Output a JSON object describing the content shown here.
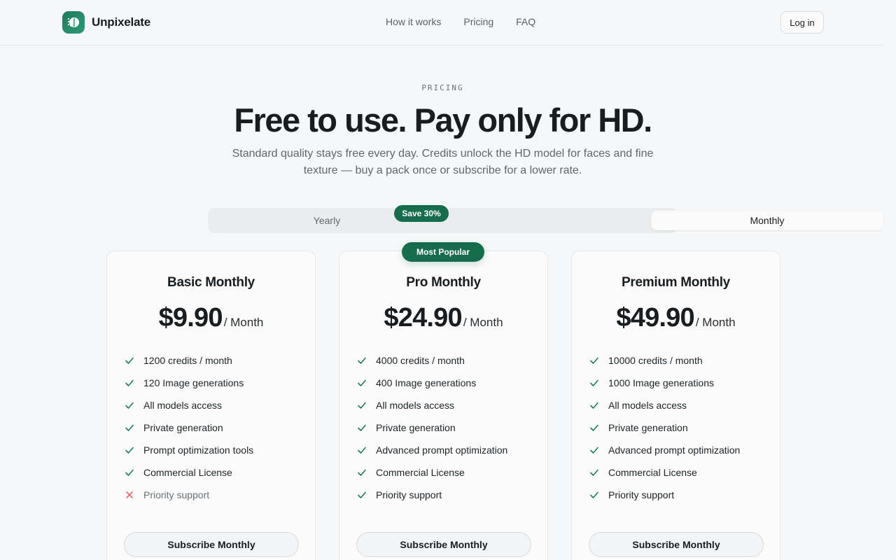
{
  "brand": {
    "name": "Unpixelate"
  },
  "nav": {
    "items": [
      "How it works",
      "Pricing",
      "FAQ"
    ]
  },
  "header": {
    "login_label": "Log in"
  },
  "hero": {
    "eyebrow": "PRICING",
    "title": "Free to use. Pay only for HD.",
    "subtitle": "Standard quality stays free every day. Credits unlock the HD model for faces and fine texture — buy a pack once or subscribe for a lower rate."
  },
  "billing_toggle": {
    "yearly_label": "Yearly",
    "monthly_label": "Monthly",
    "selected": "Monthly",
    "save_badge": "Save 30%"
  },
  "popular_badge": "Most Popular",
  "plans": [
    {
      "name": "Basic Monthly",
      "price": "$9.90",
      "period": "/ Month",
      "button": "Subscribe Monthly",
      "features": [
        {
          "text": "1200 credits / month",
          "included": true
        },
        {
          "text": "120 Image generations",
          "included": true
        },
        {
          "text": "All models access",
          "included": true
        },
        {
          "text": "Private generation",
          "included": true
        },
        {
          "text": "Prompt optimization tools",
          "included": true
        },
        {
          "text": "Commercial License",
          "included": true
        },
        {
          "text": "Priority support",
          "included": false
        }
      ]
    },
    {
      "name": "Pro Monthly",
      "price": "$24.90",
      "period": "/ Month",
      "button": "Subscribe Monthly",
      "features": [
        {
          "text": "4000 credits / month",
          "included": true
        },
        {
          "text": "400 Image generations",
          "included": true
        },
        {
          "text": "All models access",
          "included": true
        },
        {
          "text": "Private generation",
          "included": true
        },
        {
          "text": "Advanced prompt optimization",
          "included": true
        },
        {
          "text": "Commercial License",
          "included": true
        },
        {
          "text": "Priority support",
          "included": true
        }
      ]
    },
    {
      "name": "Premium Monthly",
      "price": "$49.90",
      "period": "/ Month",
      "button": "Subscribe Monthly",
      "features": [
        {
          "text": "10000 credits / month",
          "included": true
        },
        {
          "text": "1000 Image generations",
          "included": true
        },
        {
          "text": "All models access",
          "included": true
        },
        {
          "text": "Private generation",
          "included": true
        },
        {
          "text": "Advanced prompt optimization",
          "included": true
        },
        {
          "text": "Commercial License",
          "included": true
        },
        {
          "text": "Priority support",
          "included": true
        }
      ]
    }
  ],
  "colors": {
    "accent": "#176c4e",
    "check": "#1f7a5a",
    "cross": "#e06a6a"
  }
}
